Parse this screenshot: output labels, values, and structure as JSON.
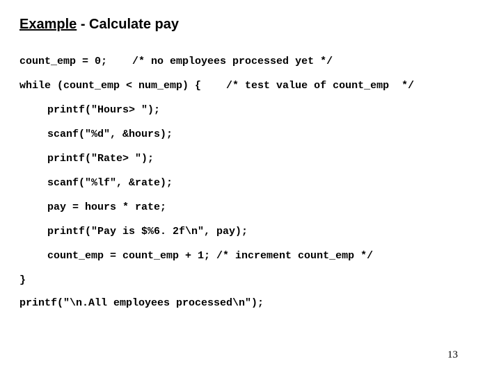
{
  "title": {
    "underlined": "Example",
    "rest": " - Calculate pay"
  },
  "code": {
    "l1": "count_emp = 0;    /* no employees processed yet */",
    "l2": "while (count_emp < num_emp) {    /* test value of count_emp  */",
    "l3": "printf(\"Hours> \");",
    "l4": "scanf(\"%d\", &hours);",
    "l5": "printf(\"Rate> \");",
    "l6": "scanf(\"%lf\", &rate);",
    "l7": "pay = hours * rate;",
    "l8": "printf(\"Pay is $%6. 2f\\n\", pay);",
    "l9": "count_emp = count_emp + 1; /* increment count_emp */",
    "l10": "}",
    "l11": "printf(\"\\n.All employees processed\\n\");"
  },
  "page_number": "13"
}
